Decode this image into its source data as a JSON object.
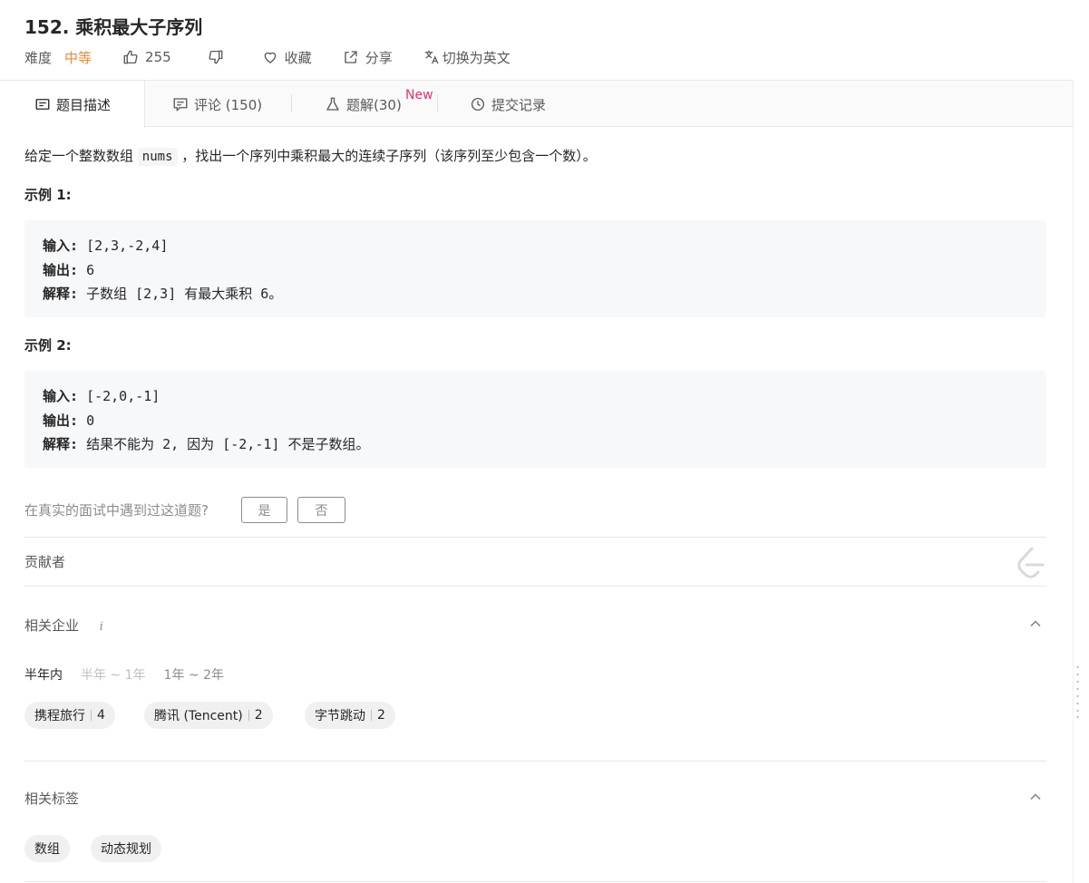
{
  "problem": {
    "title": "152. 乘积最大子序列",
    "difficulty_label": "难度",
    "difficulty": "中等",
    "likes": "255",
    "favorite_label": "收藏",
    "share_label": "分享",
    "switch_lang_label": "切换为英文"
  },
  "tabs": [
    {
      "label": "题目描述"
    },
    {
      "label": "评论 (150)"
    },
    {
      "label": "题解(30)",
      "badge": "New"
    },
    {
      "label": "提交记录"
    }
  ],
  "description": {
    "prefix": "给定一个整数数组 ",
    "code": "nums",
    "suffix": " ，找出一个序列中乘积最大的连续子序列（该序列至少包含一个数）。"
  },
  "examples": [
    {
      "title": "示例 1:",
      "input_label": "输入:",
      "input": "[2,3,-2,4]",
      "output_label": "输出:",
      "output": "6",
      "explain_label": "解释:",
      "explain": "子数组 [2,3] 有最大乘积 6。"
    },
    {
      "title": "示例 2:",
      "input_label": "输入:",
      "input": "[-2,0,-1]",
      "output_label": "输出:",
      "output": "0",
      "explain_label": "解释:",
      "explain": "结果不能为 2, 因为 [-2,-1] 不是子数组。"
    }
  ],
  "interview": {
    "question": "在真实的面试中遇到过这道题?",
    "yes": "是",
    "no": "否"
  },
  "contributors_label": "贡献者",
  "companies": {
    "label": "相关企业",
    "info": "i",
    "periods": [
      "半年内",
      "半年 ~ 1年",
      "1年 ~ 2年"
    ],
    "items": [
      {
        "name": "携程旅行",
        "count": "4"
      },
      {
        "name": "腾讯 (Tencent)",
        "count": "2"
      },
      {
        "name": "字节跳动",
        "count": "2"
      }
    ]
  },
  "tags": {
    "label": "相关标签",
    "items": [
      "数组",
      "动态规划"
    ]
  },
  "colors": {
    "difficulty_medium": "#ef8a3a",
    "new_badge": "#e3326d"
  }
}
